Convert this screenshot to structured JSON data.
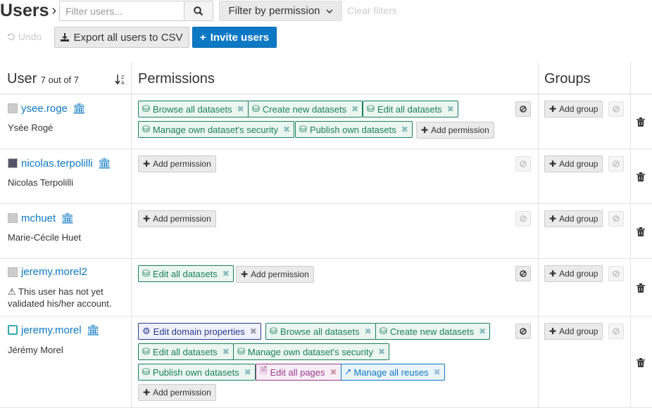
{
  "header": {
    "title": "Users",
    "search_placeholder": "Filter users...",
    "filter_label": "Filter by permission",
    "clear_label": "Clear filters",
    "undo_label": "Undo",
    "export_label": "Export all users to CSV",
    "invite_label": "Invite users"
  },
  "columns": {
    "user": "User",
    "user_count": "7 out of 7",
    "permissions": "Permissions",
    "groups": "Groups"
  },
  "labels": {
    "add_permission": "Add permission",
    "add_group": "Add group"
  },
  "users": [
    {
      "username": "ysee.roge",
      "fullname": "Ysée Rogé",
      "permissions": [
        "Browse all datasets",
        "Create new datasets",
        "Edit all datasets",
        "Manage own dataset's security",
        "Publish own datasets"
      ]
    },
    {
      "username": "nicolas.terpolilli",
      "fullname": "Nicolas Terpolilli",
      "permissions": []
    },
    {
      "username": "mchuet",
      "fullname": "Marie-Cécile Huet",
      "permissions": []
    },
    {
      "username": "jeremy.morel2",
      "warning": "This user has not yet validated his/her account.",
      "permissions": [
        "Edit all datasets"
      ]
    },
    {
      "username": "jeremy.morel",
      "fullname": "Jérémy Morel",
      "permissions": [
        "Edit domain properties",
        "Browse all datasets",
        "Create new datasets",
        "Edit all datasets",
        "Manage own dataset's security",
        "Publish own datasets",
        "Edit all pages",
        "Manage all reuses"
      ]
    }
  ],
  "colors": {
    "accent": "#0d79c4",
    "dataset_tag": "#19805a",
    "domain_tag": "#2a3b8f",
    "pages_tag": "#9b3b8f"
  }
}
